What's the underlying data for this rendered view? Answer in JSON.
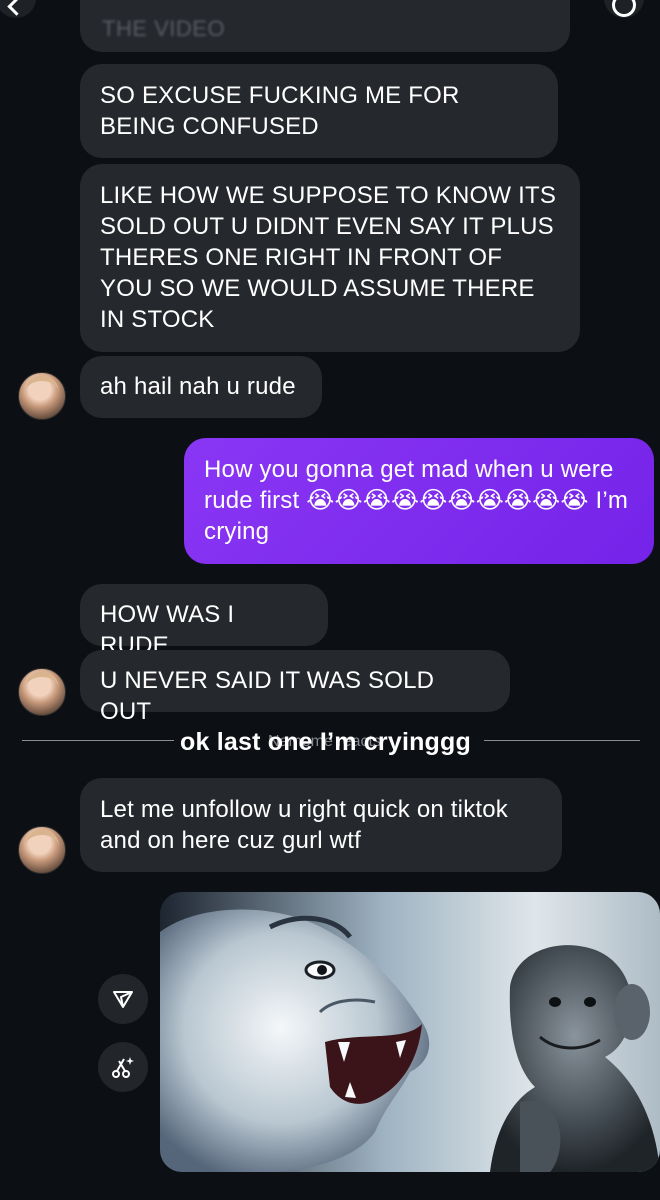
{
  "thread": {
    "faded_header_message": "THE VIDEO",
    "messages": [
      {
        "sender": "them",
        "text": "SO EXCUSE FUCKING ME FOR BEING CONFUSED"
      },
      {
        "sender": "them",
        "text": "LIKE HOW WE SUPPOSE TO KNOW ITS SOLD OUT U DIDNT EVEN SAY IT PLUS THERES ONE RIGHT IN FRONT OF YOU SO WE WOULD ASSUME THERE IN STOCK"
      },
      {
        "sender": "them",
        "text": "ah hail nah u rude"
      },
      {
        "sender": "me",
        "text": "How you gonna get mad when u were rude first 😭😭😭😭😭😭😭😭😭😭 I’m crying"
      },
      {
        "sender": "them",
        "text": "HOW WAS I RUDE"
      },
      {
        "sender": "them",
        "text": "U NEVER SAID IT WAS SOLD OUT"
      },
      {
        "sender": "them",
        "text": "Let me unfollow u right quick on tiktok and on here cuz gurl wtf"
      }
    ],
    "overlay_caption": "ok last one I’m cryinggg",
    "ghost_caption": "Nameme reacts"
  },
  "icons": {
    "top_left": "chevron-icon",
    "top_right_1": "phone-icon",
    "top_right_2": "video-icon",
    "top_right_3": "info-icon",
    "share": "send-icon",
    "magic": "ai-sparkle-icon"
  },
  "colors": {
    "background": "#0c0f14",
    "incoming_bubble": "#25282d",
    "outgoing_bubble": "#7b2ff0",
    "text": "#ffffff"
  }
}
